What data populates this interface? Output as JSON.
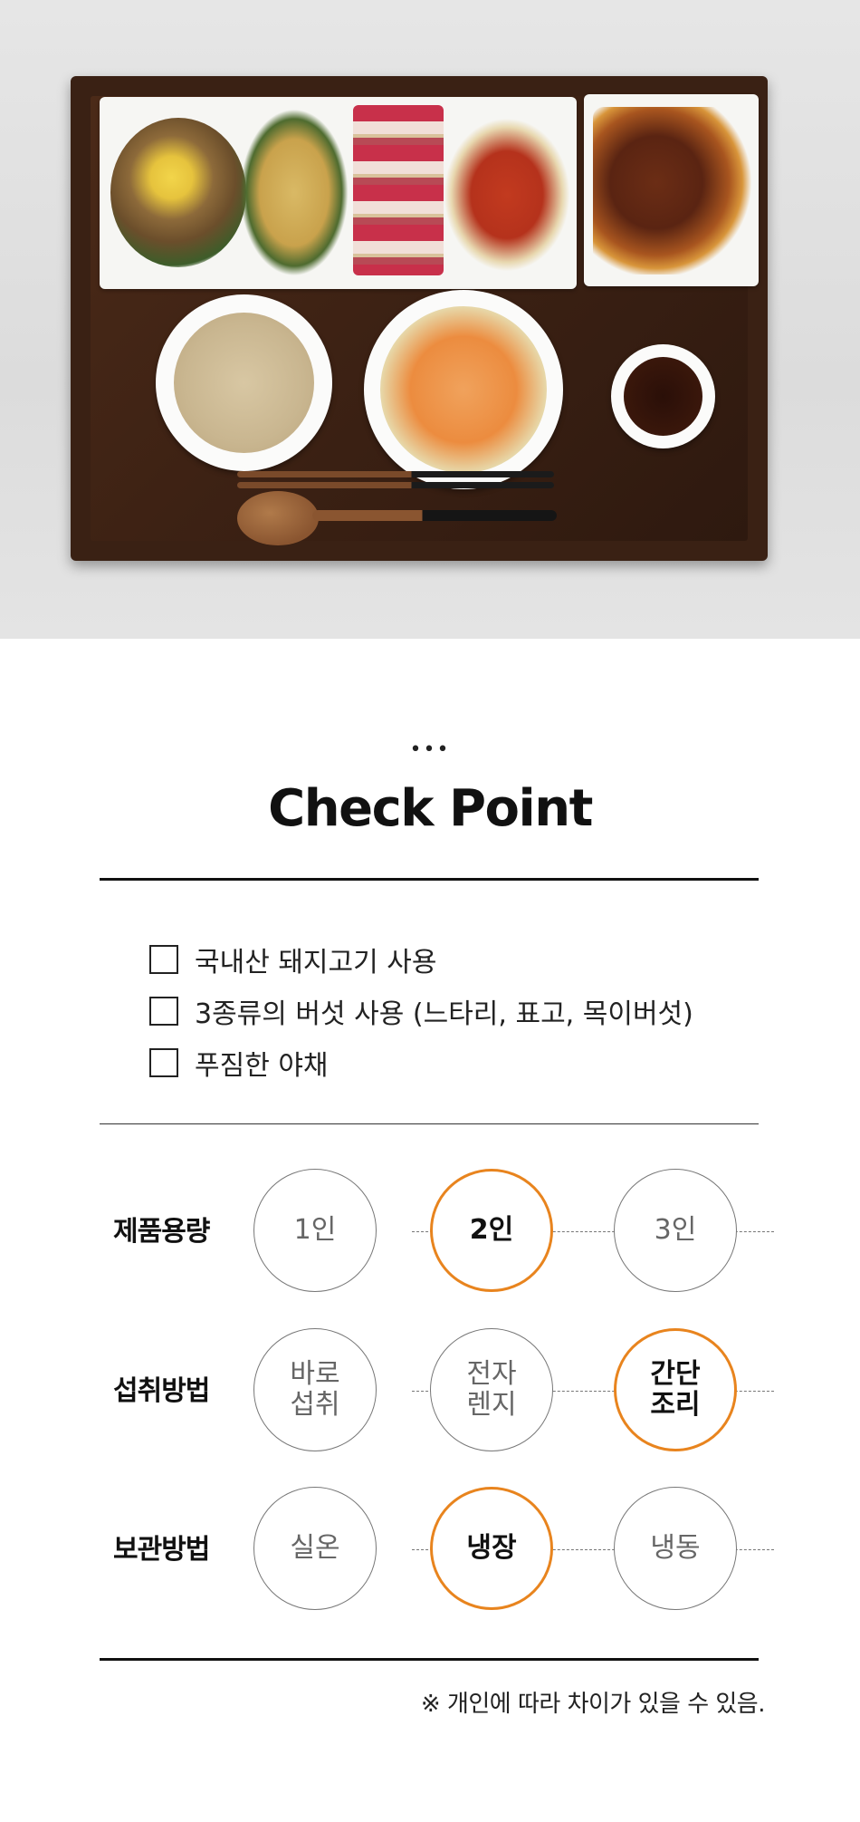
{
  "hero": {
    "image_alt": "",
    "accent_color": "#e8841e"
  },
  "checkpoint": {
    "dots": "•••",
    "title": "Check Point",
    "items": [
      "국내산 돼지고기 사용",
      "3종류의 버섯 사용 (느타리, 표고, 목이버섯)",
      "푸짐한 야채"
    ]
  },
  "options": [
    {
      "label": "제품용량",
      "choices": [
        "1인",
        "2인",
        "3인"
      ],
      "selected_index": 1
    },
    {
      "label": "섭취방법",
      "choices": [
        "바로\n섭취",
        "전자\n렌지",
        "간단\n조리"
      ],
      "selected_index": 2
    },
    {
      "label": "보관방법",
      "choices": [
        "실온",
        "냉장",
        "냉동"
      ],
      "selected_index": 1
    }
  ],
  "note": "※ 개인에 따라 차이가 있을 수 있음."
}
